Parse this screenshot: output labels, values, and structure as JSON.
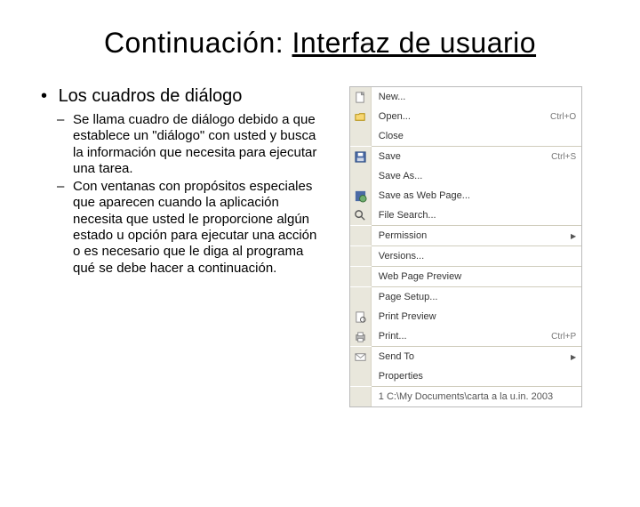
{
  "title": {
    "prefix": "Continuación: ",
    "underlined": "Interfaz de usuario"
  },
  "bullet": "Los cuadros de diálogo",
  "subbullets": [
    "Se llama cuadro de diálogo debido a que establece un \"diálogo\" con usted y busca la información que necesita para ejecutar una tarea.",
    "Con ventanas con propósitos especiales que aparecen cuando la aplicación necesita que usted le proporcione algún estado u opción para ejecutar una acción o es necesario que le diga al programa qué se debe hacer a continuación."
  ],
  "menu": {
    "new": {
      "label": "New...",
      "shortcut": ""
    },
    "open": {
      "label": "Open...",
      "shortcut": "Ctrl+O"
    },
    "close": {
      "label": "Close"
    },
    "save": {
      "label": "Save",
      "shortcut": "Ctrl+S"
    },
    "saveas": {
      "label": "Save As..."
    },
    "savewp": {
      "label": "Save as Web Page..."
    },
    "filesearch": {
      "label": "File Search..."
    },
    "permission": {
      "label": "Permission"
    },
    "versions": {
      "label": "Versions..."
    },
    "wppreview": {
      "label": "Web Page Preview"
    },
    "pagesetup": {
      "label": "Page Setup..."
    },
    "printpreview": {
      "label": "Print Preview"
    },
    "print": {
      "label": "Print...",
      "shortcut": "Ctrl+P"
    },
    "sendto": {
      "label": "Send To"
    },
    "properties": {
      "label": "Properties"
    },
    "recent": {
      "label": "1 C:\\My Documents\\carta a la u.in. 2003"
    }
  }
}
